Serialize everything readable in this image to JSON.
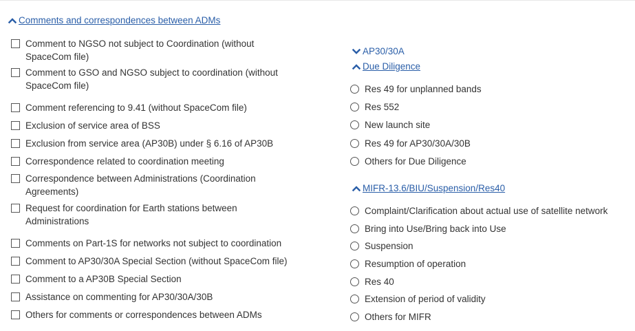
{
  "colors": {
    "link": "#2a5ea8",
    "text": "#333333",
    "border": "#555555"
  },
  "adm_section": {
    "title": "Comments and correspondences between ADMs",
    "icon": "chevron-up-icon",
    "items": [
      {
        "line1": "Comment to NGSO not subject to Coordination (without",
        "line2": "SpaceCom file)"
      },
      {
        "line1": "Comment to GSO and NGSO subject to coordination (without",
        "line2": "SpaceCom file)"
      },
      {
        "line1": "Comment referencing to 9.41 (without SpaceCom file)"
      },
      {
        "line1": "Exclusion of service area of BSS"
      },
      {
        "line1": "Exclusion from service area (AP30B) under § 6.16 of AP30B"
      },
      {
        "line1": "Correspondence related to coordination meeting"
      },
      {
        "line1": "Correspondence between Administrations (Coordination",
        "line2": "Agreements)"
      },
      {
        "line1": "Request for coordination for Earth stations between",
        "line2": "Administrations"
      },
      {
        "line1": "Comments on Part-1S for networks not subject to coordination"
      },
      {
        "line1": "Comment to AP30/30A Special Section (without SpaceCom file)"
      },
      {
        "line1": "Comment to a AP30B Special Section"
      },
      {
        "line1": "Assistance on commenting for AP30/30A/30B"
      },
      {
        "line1": "Others for comments or correspondences between ADMs"
      }
    ]
  },
  "ap30_section": {
    "title": "AP30/30A",
    "icon": "chevron-down-icon"
  },
  "due_diligence_section": {
    "title": "Due Diligence",
    "icon": "chevron-up-icon",
    "items": [
      "Res 49 for unplanned bands",
      "Res 552",
      "New launch site",
      "Res 49 for AP30/30A/30B",
      "Others for Due Diligence"
    ]
  },
  "mifr_section": {
    "title": "MIFR-13.6/BIU/Suspension/Res40",
    "icon": "chevron-up-icon",
    "items": [
      "Complaint/Clarification about actual use of satellite network",
      "Bring into Use/Bring back into Use",
      "Suspension",
      "Resumption of operation",
      "Res 40",
      "Extension of period of validity",
      "Others for MIFR"
    ]
  }
}
